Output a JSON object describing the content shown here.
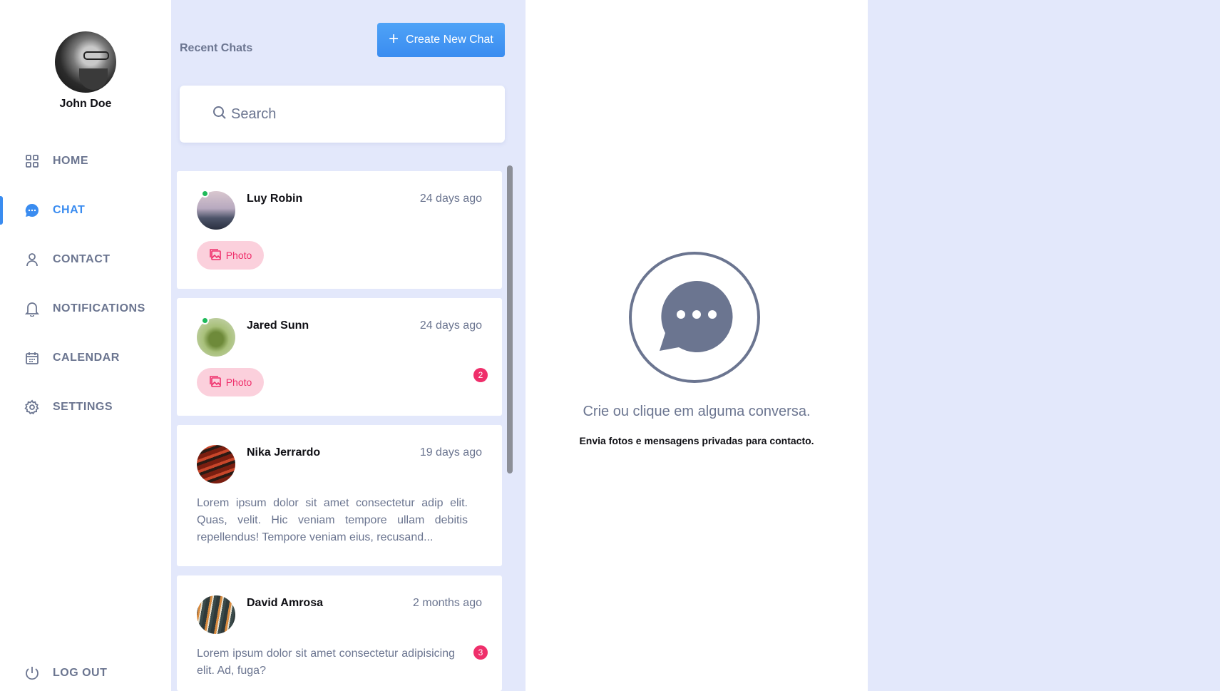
{
  "profile": {
    "name": "John Doe"
  },
  "nav": {
    "items": [
      {
        "label": "HOME",
        "icon": "grid-icon",
        "active": false
      },
      {
        "label": "CHAT",
        "icon": "chat-bubble-icon",
        "active": true
      },
      {
        "label": "CONTACT",
        "icon": "user-icon",
        "active": false
      },
      {
        "label": "NOTIFICATIONS",
        "icon": "bell-icon",
        "active": false
      },
      {
        "label": "CALENDAR",
        "icon": "calendar-icon",
        "active": false
      },
      {
        "label": "SETTINGS",
        "icon": "gear-icon",
        "active": false
      }
    ],
    "logout_label": "LOG OUT"
  },
  "chat_list": {
    "title": "Recent Chats",
    "create_label": "Create New Chat",
    "search_placeholder": "Search",
    "chats": [
      {
        "name": "Luy Robin",
        "time": "24 days ago",
        "online": true,
        "photo_tag": "Photo",
        "unread": ""
      },
      {
        "name": "Jared Sunn",
        "time": "24 days ago",
        "online": true,
        "photo_tag": "Photo",
        "unread": "2"
      },
      {
        "name": "Nika Jerrardo",
        "time": "19 days ago",
        "online": false,
        "preview": "Lorem ipsum dolor sit amet consectetur adip elit. Quas, velit. Hic veniam tempore ullam debitis repellendus! Tempore veniam eius, recusand...",
        "unread": ""
      },
      {
        "name": "David Amrosa",
        "time": "2 months ago",
        "online": false,
        "preview": "Lorem ipsum dolor sit amet consectetur adipisicing elit. Ad, fuga?",
        "unread": "3"
      }
    ]
  },
  "empty_state": {
    "title": "Crie ou clique em alguma conversa.",
    "subtitle": "Envia fotos e mensagens privadas para contacto."
  },
  "colors": {
    "accent": "#3a8cf0",
    "muted_text": "#6b7590",
    "panel_bg": "#e3e8fb",
    "online": "#1fba5a",
    "badge": "#ef2f6b",
    "photo_tag_bg": "#fbd0dc"
  }
}
